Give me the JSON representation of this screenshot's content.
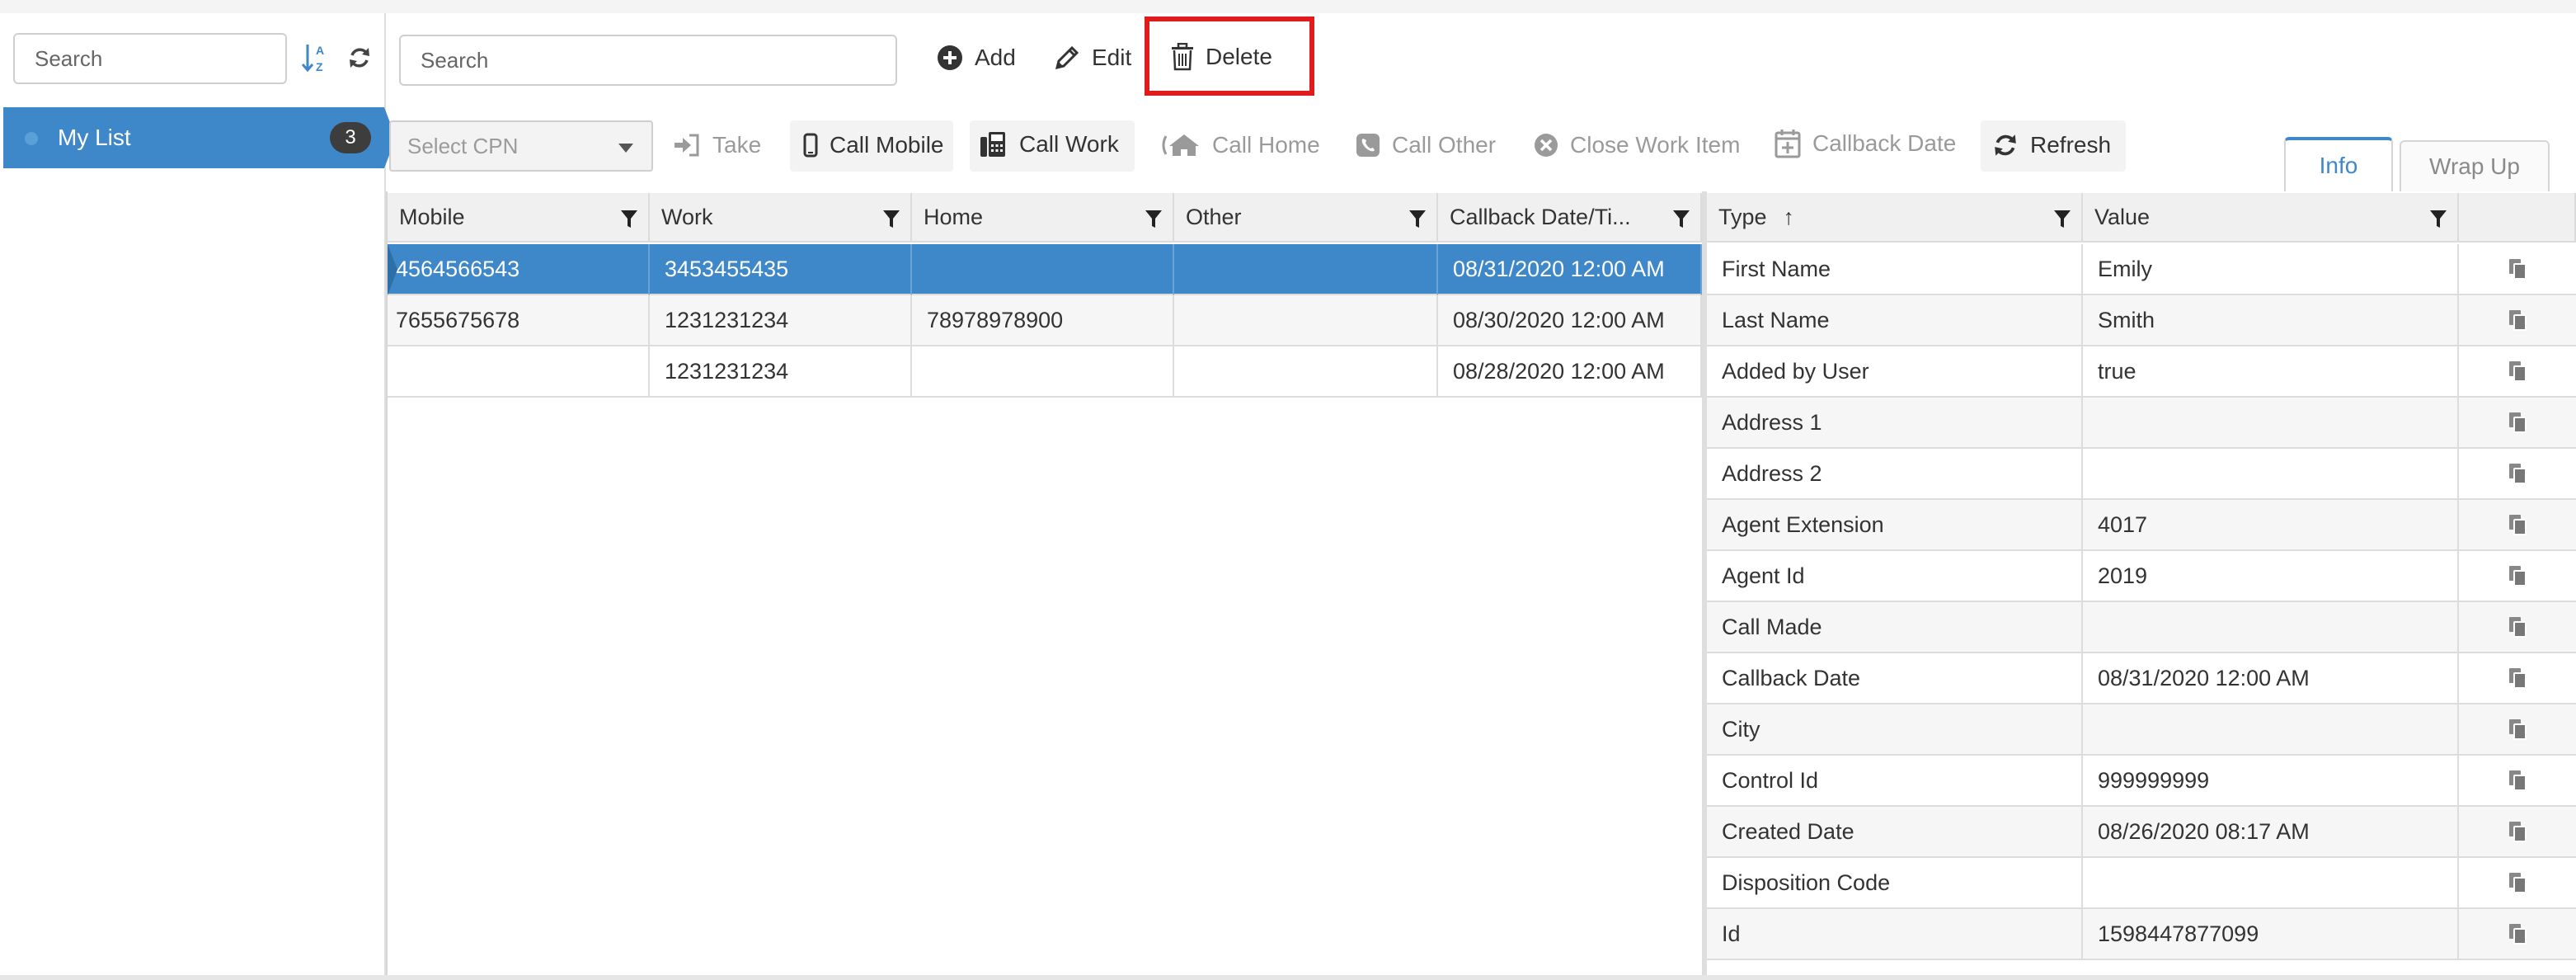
{
  "sidebar": {
    "search_placeholder": "Search",
    "list": {
      "label": "My List",
      "count": "3"
    }
  },
  "toolbar": {
    "search_placeholder": "Search",
    "add_label": "Add",
    "edit_label": "Edit",
    "delete_label": "Delete"
  },
  "actions": {
    "cpn_placeholder": "Select CPN",
    "take_label": "Take",
    "call_mobile_label": "Call Mobile",
    "call_work_label": "Call Work",
    "call_home_label": "Call Home",
    "call_other_label": "Call Other",
    "close_work_item_label": "Close Work Item",
    "callback_date_label": "Callback Date",
    "refresh_label": "Refresh"
  },
  "tabs": {
    "info": "Info",
    "wrap_up": "Wrap Up"
  },
  "contacts": {
    "headers": [
      "Mobile",
      "Work",
      "Home",
      "Other",
      "Callback Date/Ti..."
    ],
    "rows": [
      [
        "4564566543",
        "3453455435",
        "",
        "",
        "08/31/2020 12:00 AM"
      ],
      [
        "7655675678",
        "1231231234",
        "78978978900",
        "",
        "08/30/2020 12:00 AM"
      ],
      [
        "",
        "1231231234",
        "",
        "",
        "08/28/2020 12:00 AM"
      ]
    ]
  },
  "details": {
    "headers": {
      "type": "Type",
      "sort_indicator": "↑",
      "value": "Value"
    },
    "rows": [
      [
        "First Name",
        "Emily"
      ],
      [
        "Last Name",
        "Smith"
      ],
      [
        "Added by User",
        "true"
      ],
      [
        "Address 1",
        ""
      ],
      [
        "Address 2",
        ""
      ],
      [
        "Agent Extension",
        "4017"
      ],
      [
        "Agent Id",
        "2019"
      ],
      [
        "Call Made",
        ""
      ],
      [
        "Callback Date",
        "08/31/2020 12:00 AM"
      ],
      [
        "City",
        ""
      ],
      [
        "Control Id",
        "999999999"
      ],
      [
        "Created Date",
        "08/26/2020 08:17 AM"
      ],
      [
        "Disposition Code",
        ""
      ],
      [
        "Id",
        "1598447877099"
      ]
    ]
  },
  "colors": {
    "accent": "#3e88c9",
    "highlight": "#e01b1b"
  }
}
